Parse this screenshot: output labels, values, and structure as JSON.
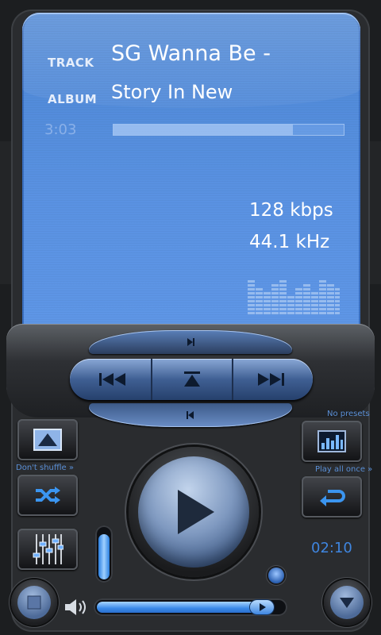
{
  "now_playing": {
    "track_label": "TRACK",
    "track_title": "SG Wanna Be -",
    "album_label": "ALBUM",
    "album_title": "Story In New",
    "elapsed": "3:03",
    "progress_fraction": 0.78,
    "bitrate": "128 kbps",
    "sample_rate": "44.1 kHz"
  },
  "labels": {
    "presets": "No presets",
    "shuffle": "Don't shuffle »",
    "repeat": "Play all once »"
  },
  "counter": "02:10",
  "volume_fraction": 0.9,
  "seek_fraction": 0.93,
  "colors": {
    "screen": "#5a92e2",
    "accent": "#3f86e0",
    "body": "#1c1e20"
  }
}
